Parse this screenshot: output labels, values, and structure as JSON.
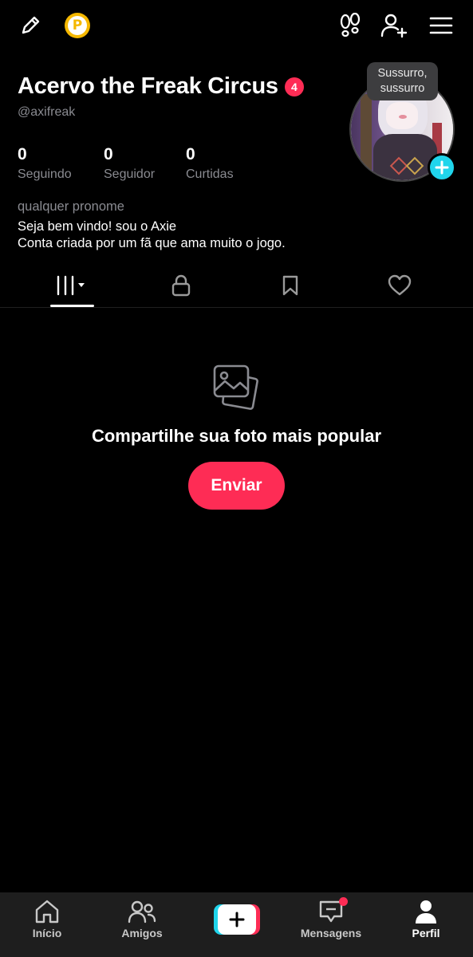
{
  "topbar": {
    "edit_icon": "pencil-icon",
    "coin_icon": "coin-icon",
    "coin_letter": "P",
    "footprints_icon": "footprints-icon",
    "add_friend_icon": "add-user-icon",
    "menu_icon": "hamburger-menu-icon"
  },
  "profile": {
    "name": "Acervo the Freak Circus",
    "badge_count": "4",
    "handle": "@axifreak",
    "tooltip": "Sussurro, sussurro",
    "stats": [
      {
        "value": "0",
        "label": "Seguindo"
      },
      {
        "value": "0",
        "label": "Seguidor"
      },
      {
        "value": "0",
        "label": "Curtidas"
      }
    ],
    "pronoun": "qualquer pronome",
    "bio_lines": [
      "Seja bem vindo! sou o Axie",
      "Conta criada por um fã que ama muito o jogo."
    ]
  },
  "tabs": [
    {
      "icon": "grid-videos-icon",
      "active": true
    },
    {
      "icon": "lock-icon",
      "active": false
    },
    {
      "icon": "bookmark-icon",
      "active": false
    },
    {
      "icon": "heart-icon",
      "active": false
    }
  ],
  "empty_state": {
    "icon": "photos-icon",
    "title": "Compartilhe sua foto mais popular",
    "button_label": "Enviar"
  },
  "bottom_nav": [
    {
      "label": "Início",
      "icon": "home-icon",
      "active": false
    },
    {
      "label": "Amigos",
      "icon": "friends-icon",
      "active": false
    },
    {
      "label": "",
      "icon": "create-plus-icon",
      "active": false
    },
    {
      "label": "Mensagens",
      "icon": "messages-icon",
      "active": false,
      "has_dot": true
    },
    {
      "label": "Perfil",
      "icon": "profile-icon",
      "active": true
    }
  ],
  "colors": {
    "accent": "#fe2c55",
    "cyan": "#20d5ec",
    "background": "#000000",
    "muted_text": "#8a8b91"
  }
}
